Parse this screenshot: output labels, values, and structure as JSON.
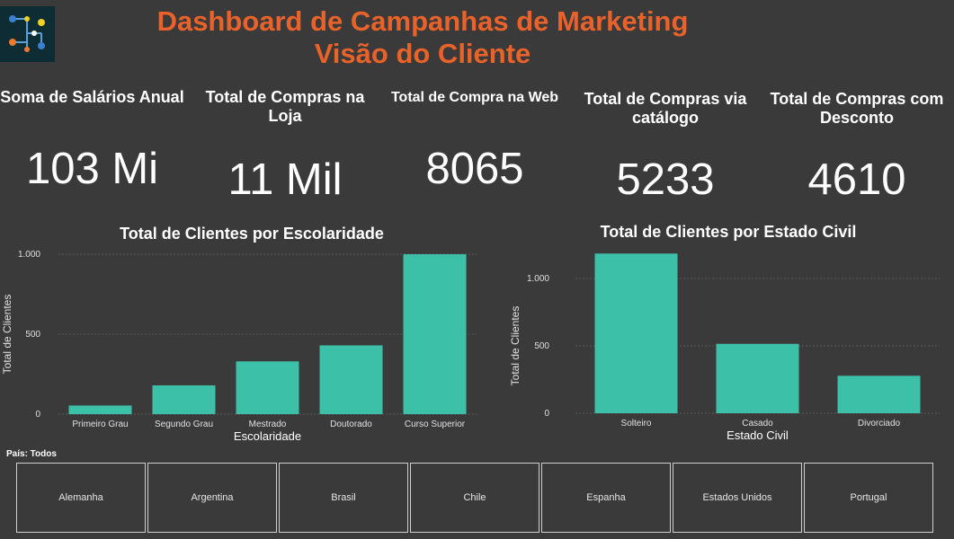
{
  "header": {
    "title_line1": "Dashboard de Campanhas de Marketing",
    "title_line2": "Visão do Cliente"
  },
  "kpis": [
    {
      "label": "Soma de Salários Anual",
      "value": "103 Mi"
    },
    {
      "label": "Total de Compras na Loja",
      "value": "11 Mil"
    },
    {
      "label": "Total de Compra na Web",
      "value": "8065"
    },
    {
      "label": "Total de Compras via catálogo",
      "value": "5233"
    },
    {
      "label": "Total de Compras com Desconto",
      "value": "4610"
    }
  ],
  "colors": {
    "bar": "#3cc0a8",
    "title": "#e8622a",
    "background": "#3a3a3a"
  },
  "chart_data": [
    {
      "type": "bar",
      "title": "Total de Clientes por Escolaridade",
      "xlabel": "Escolaridade",
      "ylabel": "Total de Clientes",
      "categories": [
        "Primeiro Grau",
        "Segundo Grau",
        "Mestrado",
        "Doutorado",
        "Curso Superior"
      ],
      "values": [
        54,
        180,
        330,
        430,
        1000
      ],
      "yticks": [
        {
          "v": 0,
          "label": "0"
        },
        {
          "v": 500,
          "label": "500"
        },
        {
          "v": 1000,
          "label": "1.000"
        }
      ],
      "ylim": [
        0,
        1000
      ],
      "grid": true
    },
    {
      "type": "bar",
      "title": "Total de Clientes por Estado Civil",
      "xlabel": "Estado Civil",
      "ylabel": "Total de Clientes",
      "categories": [
        "Solteiro",
        "Casado",
        "Divorciado"
      ],
      "values": [
        1185,
        515,
        278
      ],
      "yticks": [
        {
          "v": 0,
          "label": "0"
        },
        {
          "v": 500,
          "label": "500"
        },
        {
          "v": 1000,
          "label": "1.000"
        }
      ],
      "ylim": [
        0,
        1000
      ],
      "grid": true
    }
  ],
  "filter": {
    "label": "País: Todos",
    "options": [
      "Alemanha",
      "Argentina",
      "Brasil",
      "Chile",
      "Espanha",
      "Estados Unidos",
      "Portugal"
    ]
  }
}
